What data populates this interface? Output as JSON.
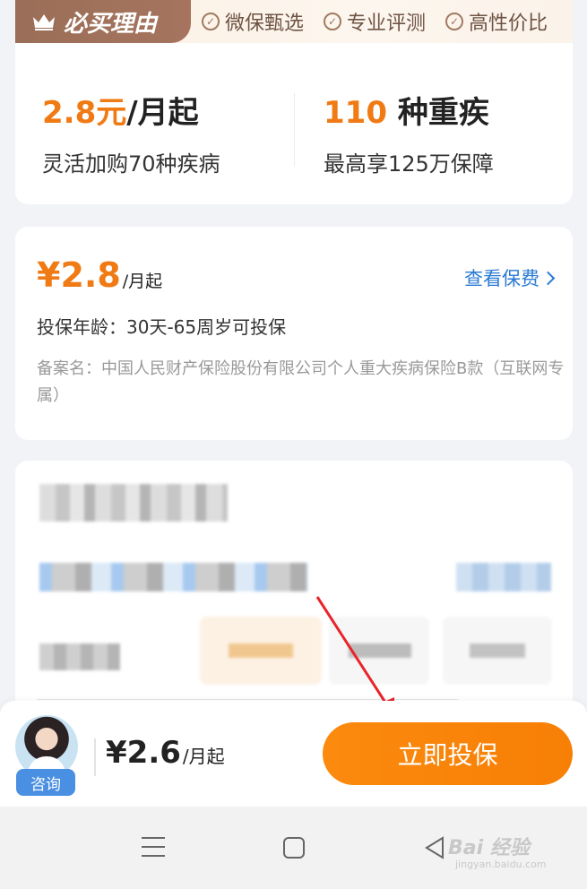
{
  "reasons": {
    "badge": "必买理由",
    "tags": [
      "微保甄选",
      "专业评测",
      "高性价比"
    ]
  },
  "stats": {
    "left": {
      "highlight": "2.8元",
      "suffix": "/月起",
      "sub": "灵活加购70种疾病"
    },
    "right": {
      "highlight": "110",
      "suffix": " 种重疾",
      "sub": "最高享125万保障"
    }
  },
  "price_card": {
    "price": "¥2.8",
    "unit": "/月起",
    "view_link": "查看保费",
    "age": "投保年龄：30天-65周岁可投保",
    "filing": "备案名：中国人民财产保险股份有限公司个人重大疾病保险B款（互联网专属）"
  },
  "bottom_bar": {
    "consult": "咨询",
    "price": "¥2.6",
    "unit": "/月起",
    "buy": "立即投保"
  },
  "watermark": {
    "brand": "Bai 经验",
    "url": "jingyan.baidu.com"
  },
  "colors": {
    "accent": "#f07a14",
    "link": "#2a7ad4",
    "button": "#fb8a0e"
  }
}
